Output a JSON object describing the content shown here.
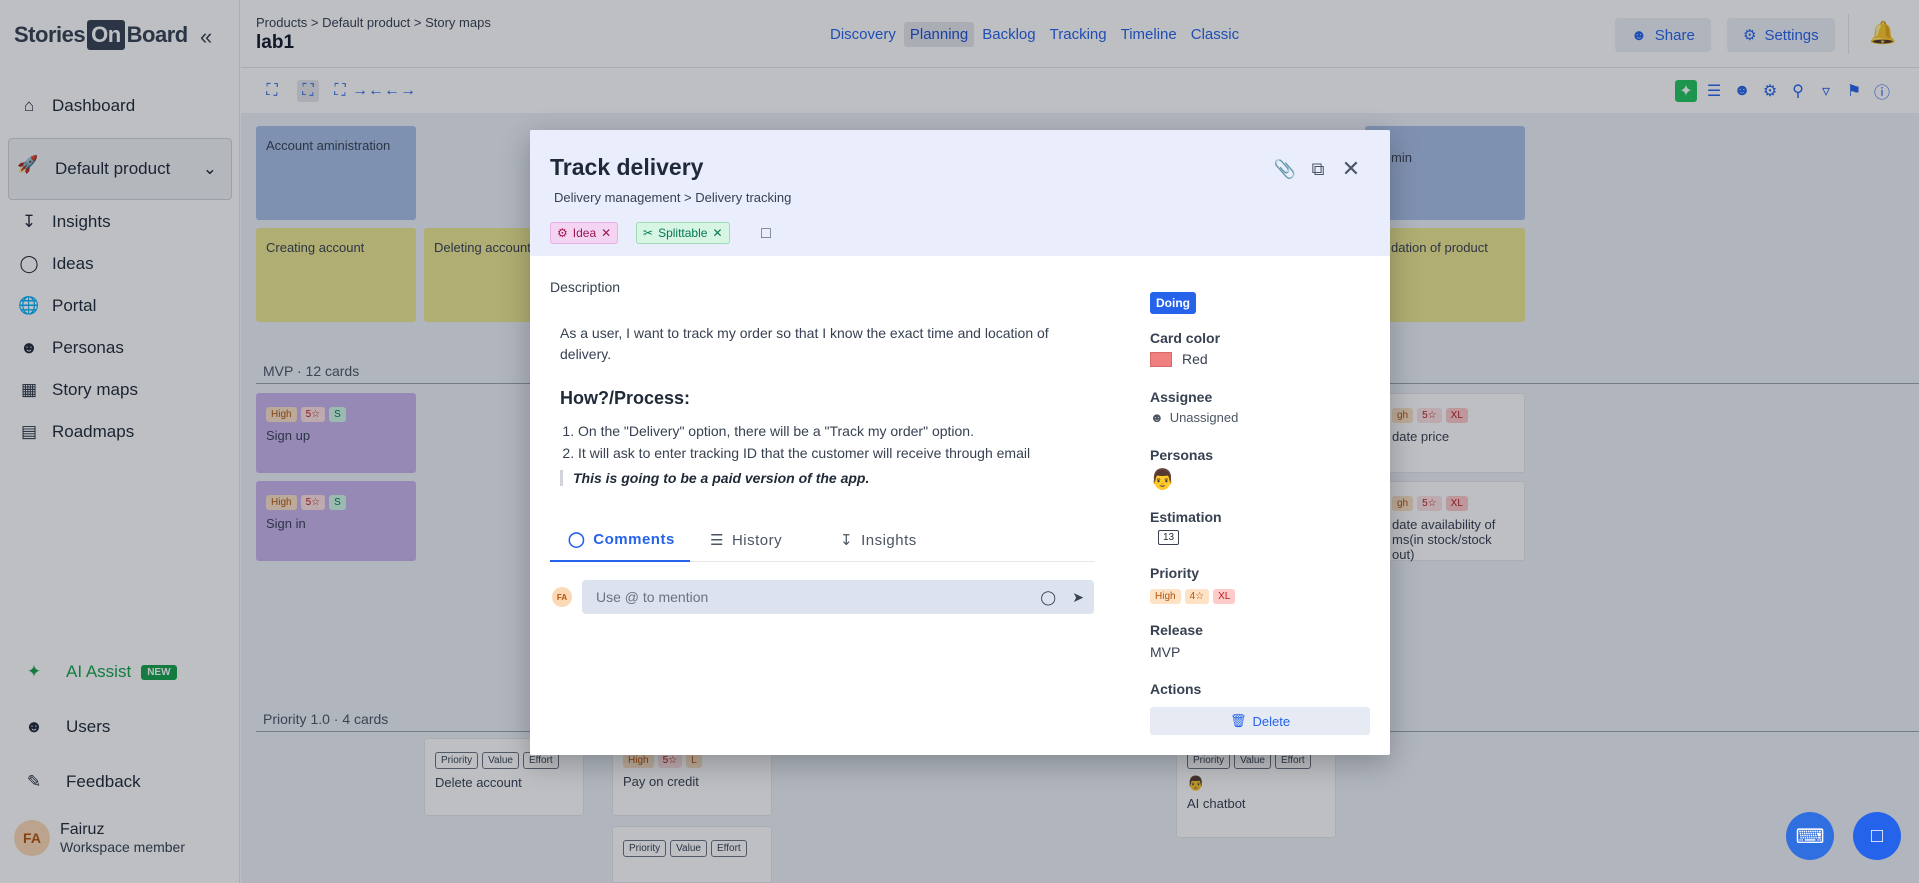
{
  "app": {
    "logo_left": "Stories",
    "logo_mid": "On",
    "logo_right": "Board"
  },
  "sidebar": {
    "items": [
      {
        "label": "Dashboard",
        "icon": "home-icon"
      },
      {
        "label": "Insights",
        "icon": "inbox-icon"
      },
      {
        "label": "Ideas",
        "icon": "lightbulb-icon"
      },
      {
        "label": "Portal",
        "icon": "globe-icon"
      },
      {
        "label": "Personas",
        "icon": "person-icon"
      },
      {
        "label": "Story maps",
        "icon": "grid-icon"
      },
      {
        "label": "Roadmaps",
        "icon": "chart-icon"
      }
    ],
    "product": "Default product",
    "ai_assist": "AI Assist",
    "ai_new": "NEW",
    "users": "Users",
    "feedback": "Feedback",
    "user_initials": "FA",
    "user_name": "Fairuz",
    "user_role": "Workspace member"
  },
  "header": {
    "breadcrumb": "Products > Default product > Story maps",
    "title": "lab1",
    "tabs": [
      "Discovery",
      "Planning",
      "Backlog",
      "Tracking",
      "Timeline",
      "Classic"
    ],
    "active_tab": "Planning",
    "share": "Share",
    "settings": "Settings"
  },
  "board": {
    "activities": [
      "Account aministration"
    ],
    "right_top": "min",
    "tasks": [
      "Creating account",
      "Deleting account",
      "dation of product"
    ],
    "release1_label": "MVP · 12 cards",
    "release2_label": "Priority 1.0 · 4 cards",
    "mvp_cards": [
      {
        "title": "Sign up",
        "chips": [
          "High",
          "5☆",
          "S"
        ]
      },
      {
        "title": "Sign in",
        "chips": [
          "High",
          "5☆",
          "S"
        ]
      }
    ],
    "right_cards": [
      {
        "title": "date price",
        "chips": [
          "gh",
          "5☆",
          "XL"
        ]
      },
      {
        "title": "date availability of ms(in stock/stock out)",
        "chips": [
          "gh",
          "5☆",
          "XL"
        ]
      }
    ],
    "p1_cards": [
      {
        "title": "Delete account",
        "chips": [
          "Priority",
          "Value",
          "Effort"
        ]
      },
      {
        "title": "Pay on credit",
        "chips": [
          "High",
          "5☆",
          "L"
        ]
      },
      {
        "title": "AI chatbot",
        "chips": [
          "Priority",
          "Value",
          "Effort"
        ]
      }
    ],
    "p1_bottom_chips": [
      "Priority",
      "Value",
      "Effort"
    ]
  },
  "modal": {
    "title": "Track delivery",
    "breadcrumb": "Delivery management > Delivery tracking",
    "tags": [
      {
        "label": "Idea",
        "color": "#f3d4f3"
      },
      {
        "label": "Splittable",
        "color": "#d7f5e3"
      }
    ],
    "description_label": "Description",
    "description": "As a user, I want to track my order so that I know the exact time and location of delivery.",
    "how_heading": "How?/Process:",
    "steps": [
      "On the \"Delivery\" option, there will be a \"Track my order\" option.",
      "It will ask to enter tracking ID that the customer will receive through email"
    ],
    "quote": "This is going to be a paid version of the app.",
    "tabs": [
      "Comments",
      "History",
      "Insights"
    ],
    "active_tab": "Comments",
    "comment_initials": "FA",
    "comment_placeholder": "Use @ to mention",
    "status": "Doing",
    "card_color_label": "Card color",
    "card_color": "Red",
    "card_color_hex": "#f08080",
    "assignee_label": "Assignee",
    "assignee": "Unassigned",
    "personas_label": "Personas",
    "estimation_label": "Estimation",
    "estimation": "13",
    "priority_label": "Priority",
    "priority_chips": [
      "High",
      "4☆",
      "XL"
    ],
    "release_label": "Release",
    "release": "MVP",
    "actions_label": "Actions",
    "delete": "Delete"
  },
  "colors": {
    "accent": "#2563eb",
    "ai": "#16a34a",
    "modal_header": "#e9edfc"
  }
}
